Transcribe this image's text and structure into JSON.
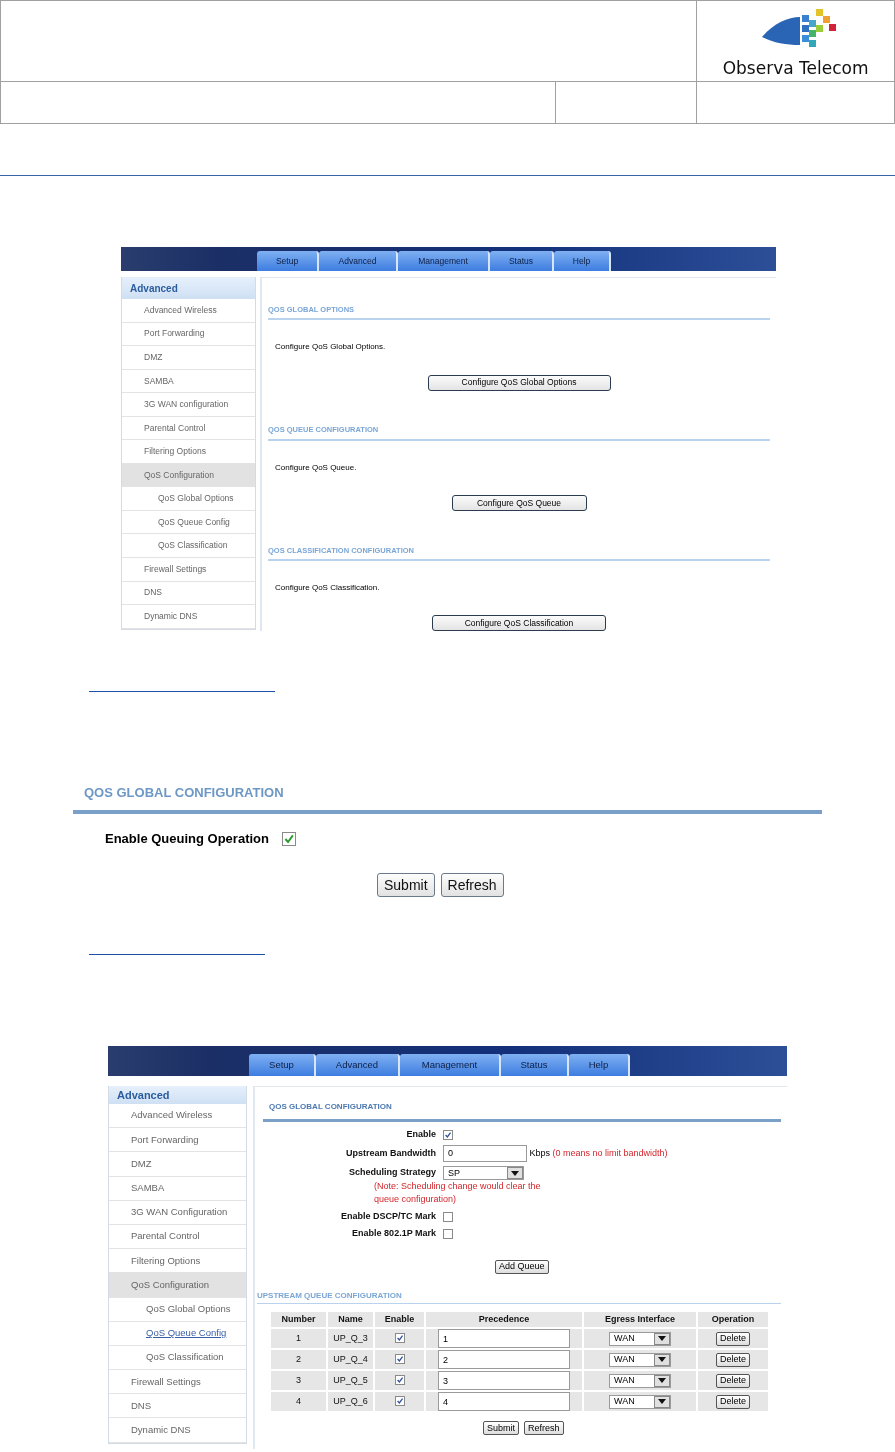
{
  "document_header": {
    "logo_text": "Observa Telecom"
  },
  "shot_1": {
    "tabs": [
      "Setup",
      "Advanced",
      "Management",
      "Status",
      "Help"
    ],
    "sidebar": {
      "title": "Advanced",
      "items": [
        {
          "label": "Advanced Wireless",
          "selected": false
        },
        {
          "label": "Port Forwarding",
          "selected": false
        },
        {
          "label": "DMZ",
          "selected": false
        },
        {
          "label": "SAMBA",
          "selected": false
        },
        {
          "label": "3G WAN configuration",
          "selected": false
        },
        {
          "label": "Parental Control",
          "selected": false
        },
        {
          "label": "Filtering Options",
          "selected": false
        },
        {
          "label": "QoS Configuration",
          "selected": true,
          "children": [
            {
              "label": "QoS Global Options",
              "selected": false
            },
            {
              "label": "QoS Queue Config",
              "selected": false
            },
            {
              "label": "QoS Classification",
              "selected": false
            }
          ]
        },
        {
          "label": "Firewall Settings",
          "selected": false
        },
        {
          "label": "DNS",
          "selected": false
        },
        {
          "label": "Dynamic DNS",
          "selected": false
        }
      ]
    },
    "sections": [
      {
        "title": "QOS GLOBAL OPTIONS",
        "description": "Configure QoS Global Options.",
        "button": "Configure QoS Global Options"
      },
      {
        "title": "QOS QUEUE CONFIGURATION",
        "description": "Configure QoS Queue.",
        "button": "Configure QoS Queue"
      },
      {
        "title": "QOS CLASSIFICATION CONFIGURATION",
        "description": "Configure QoS Classification.",
        "button": "Configure QoS Classification"
      }
    ]
  },
  "shot_2": {
    "title": "QOS GLOBAL CONFIGURATION",
    "option": {
      "label": "Enable Queuing Operation",
      "checked": true
    },
    "buttons": [
      "Submit",
      "Refresh"
    ]
  },
  "shot_3": {
    "tabs": [
      "Setup",
      "Advanced",
      "Management",
      "Status",
      "Help"
    ],
    "sidebar": {
      "title": "Advanced",
      "items": [
        {
          "label": "Advanced Wireless",
          "selected": false
        },
        {
          "label": "Port Forwarding",
          "selected": false
        },
        {
          "label": "DMZ",
          "selected": false
        },
        {
          "label": "SAMBA",
          "selected": false
        },
        {
          "label": "3G WAN Configuration",
          "selected": false
        },
        {
          "label": "Parental Control",
          "selected": false
        },
        {
          "label": "Filtering Options",
          "selected": false
        },
        {
          "label": "QoS Configuration",
          "selected": true,
          "children": [
            {
              "label": "QoS Global Options",
              "selected": false
            },
            {
              "label": "QoS Queue Config",
              "selected": true
            },
            {
              "label": "QoS Classification",
              "selected": false
            }
          ]
        },
        {
          "label": "Firewall Settings",
          "selected": false
        },
        {
          "label": "DNS",
          "selected": false
        },
        {
          "label": "Dynamic DNS",
          "selected": false
        }
      ]
    },
    "global": {
      "title": "QOS GLOBAL CONFIGURATION",
      "fields": [
        {
          "kind": "checkbox",
          "label": "Enable",
          "checked": true
        },
        {
          "kind": "text",
          "label": "Upstream Bandwidth",
          "value": "0",
          "unit": "Kbps",
          "note": "(0 means no limit bandwidth)"
        },
        {
          "kind": "select",
          "label": "Scheduling Strategy",
          "value": "SP",
          "note": "(Note: Scheduling change would clear the queue configuration)"
        },
        {
          "kind": "checkbox",
          "label": "Enable DSCP/TC Mark",
          "checked": false
        },
        {
          "kind": "checkbox",
          "label": "Enable 802.1P Mark",
          "checked": false
        }
      ],
      "button": "Add Queue"
    },
    "queue": {
      "title": "UPSTREAM QUEUE CONFIGURATION",
      "columns": [
        "Number",
        "Name",
        "Enable",
        "Precedence",
        "Egress Interface",
        "Operation"
      ],
      "rows": [
        {
          "number": "1",
          "name": "UP_Q_3",
          "enabled": true,
          "precedence": "1",
          "egress": "WAN",
          "operation": "Delete"
        },
        {
          "number": "2",
          "name": "UP_Q_4",
          "enabled": true,
          "precedence": "2",
          "egress": "WAN",
          "operation": "Delete"
        },
        {
          "number": "3",
          "name": "UP_Q_5",
          "enabled": true,
          "precedence": "3",
          "egress": "WAN",
          "operation": "Delete"
        },
        {
          "number": "4",
          "name": "UP_Q_6",
          "enabled": true,
          "precedence": "4",
          "egress": "WAN",
          "operation": "Delete"
        }
      ]
    },
    "buttons": [
      "Submit",
      "Refresh"
    ]
  }
}
